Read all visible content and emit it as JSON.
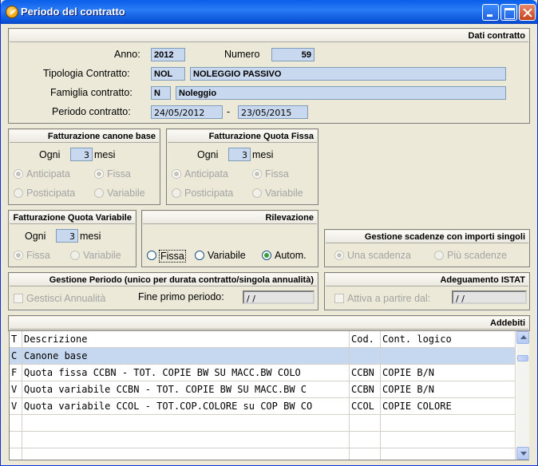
{
  "window": {
    "title": "Periodo del contratto"
  },
  "contract": {
    "header": "Dati contratto",
    "anno_label": "Anno:",
    "anno": "2012",
    "numero_label": "Numero",
    "numero": "59",
    "tipologia_label": "Tipologia Contratto:",
    "tipologia_code": "NOL",
    "tipologia_desc": "NOLEGGIO PASSIVO",
    "famiglia_label": "Famiglia contratto:",
    "famiglia_code": "N",
    "famiglia_desc": "Noleggio",
    "periodo_label": "Periodo contratto:",
    "periodo_from": "24/05/2012",
    "periodo_sep": "-",
    "periodo_to": "23/05/2015"
  },
  "canone_base": {
    "header": "Fatturazione canone base",
    "ogni_label": "Ogni",
    "ogni": "3",
    "mesi": "mesi",
    "anticipata": "Anticipata",
    "posticipata": "Posticipata",
    "fissa": "Fissa",
    "variabile": "Variabile"
  },
  "quota_fissa": {
    "header": "Fatturazione Quota Fissa",
    "ogni_label": "Ogni",
    "ogni": "3",
    "mesi": "mesi",
    "anticipata": "Anticipata",
    "posticipata": "Posticipata",
    "fissa": "Fissa",
    "variabile": "Variabile"
  },
  "quota_variabile": {
    "header": "Fatturazione Quota Variabile",
    "ogni_label": "Ogni",
    "ogni": "3",
    "mesi": "mesi",
    "fissa": "Fissa",
    "variabile": "Variabile"
  },
  "rilevazione": {
    "header": "Rilevazione",
    "fissa": "Fissa",
    "variabile": "Variabile",
    "autom": "Autom.",
    "selected": "Autom."
  },
  "scadenze": {
    "header": "Gestione scadenze con importi singoli",
    "una": "Una scadenza",
    "piu": "Più scadenze"
  },
  "gestione_periodo": {
    "header": "Gestione Periodo (unico per durata contratto/singola annualità)",
    "gestisci": "Gestisci Annualità",
    "fine_label": "Fine primo periodo:",
    "fine_value": " /  /"
  },
  "istat": {
    "header": "Adeguamento ISTAT",
    "attiva": "Attiva a partire dal:",
    "date_value": " /  /"
  },
  "addebiti": {
    "header": "Addebiti",
    "columns": [
      "T",
      "Descrizione",
      "Cod.",
      "Cont. logico"
    ],
    "rows": [
      {
        "t": "C",
        "desc": "Canone base",
        "cod": "",
        "cont": ""
      },
      {
        "t": "F",
        "desc": "Quota fissa CCBN - TOT. COPIE BW  SU MACC.BW COLO",
        "cod": "CCBN",
        "cont": "COPIE B/N"
      },
      {
        "t": "V",
        "desc": "Quota variabile CCBN - TOT. COPIE BW  SU MACC.BW C",
        "cod": "CCBN",
        "cont": "COPIE B/N"
      },
      {
        "t": "V",
        "desc": "Quota variabile CCOL - TOT.COP.COLORE su COP BW CO",
        "cod": "CCOL",
        "cont": "COPIE COLORE"
      }
    ]
  }
}
